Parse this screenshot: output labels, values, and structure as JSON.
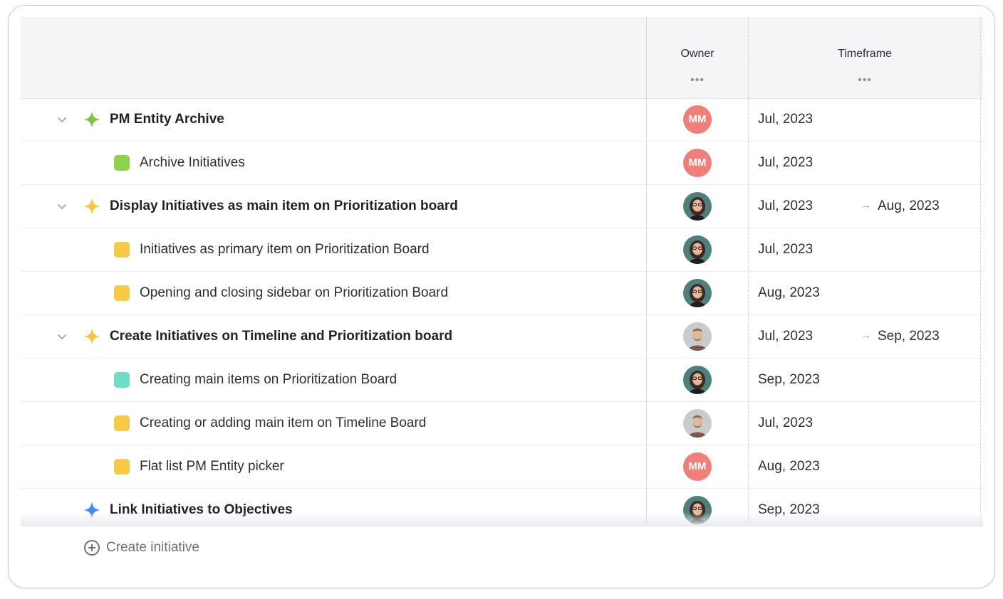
{
  "columns": {
    "owner": "Owner",
    "timeframe": "Timeframe",
    "more": "•••"
  },
  "rows": [
    {
      "title": "PM Entity Archive",
      "level": "parent",
      "icon": "star-icon",
      "color": "#7cc243",
      "owner": "MM",
      "owner_type": "initials",
      "start": "Jul, 2023",
      "end": ""
    },
    {
      "title": "Archive Initiatives",
      "level": "child",
      "icon": "square-icon",
      "color": "#8fd14f",
      "owner": "MM",
      "owner_type": "initials",
      "start": "Jul, 2023",
      "end": ""
    },
    {
      "title": "Display Initiatives as main item on Prioritization board",
      "level": "parent",
      "icon": "star-icon",
      "color": "#f7c544",
      "owner": "",
      "owner_type": "woman",
      "start": "Jul, 2023",
      "end": "Aug, 2023"
    },
    {
      "title": "Initiatives as primary item on Prioritization Board",
      "level": "child",
      "icon": "square-icon",
      "color": "#f7c948",
      "owner": "",
      "owner_type": "woman",
      "start": "Jul, 2023",
      "end": ""
    },
    {
      "title": "Opening and closing sidebar on Prioritization Board",
      "level": "child",
      "icon": "square-icon",
      "color": "#f7c948",
      "owner": "",
      "owner_type": "woman",
      "start": "Aug, 2023",
      "end": ""
    },
    {
      "title": "Create Initiatives on Timeline and Prioritization board",
      "level": "parent",
      "icon": "star-icon",
      "color": "#f7c544",
      "owner": "",
      "owner_type": "man",
      "start": "Jul, 2023",
      "end": "Sep, 2023"
    },
    {
      "title": "Creating main items on Prioritization Board",
      "level": "child",
      "icon": "square-icon",
      "color": "#6ddcc8",
      "owner": "",
      "owner_type": "woman",
      "start": "Sep, 2023",
      "end": ""
    },
    {
      "title": "Creating or adding main item on Timeline Board",
      "level": "child",
      "icon": "square-icon",
      "color": "#f7c948",
      "owner": "",
      "owner_type": "man",
      "start": "Jul, 2023",
      "end": ""
    },
    {
      "title": "Flat list PM Entity picker",
      "level": "child",
      "icon": "square-icon",
      "color": "#f7c948",
      "owner": "MM",
      "owner_type": "initials",
      "start": "Aug, 2023",
      "end": ""
    },
    {
      "title": "Link Initiatives to Objectives",
      "level": "parent_no_toggle",
      "icon": "star-icon",
      "color": "#3d8ef5",
      "owner": "",
      "owner_type": "woman",
      "start": "Sep, 2023",
      "end": ""
    }
  ],
  "arrow": "→",
  "footer": {
    "create_label": "Create initiative",
    "icon": "plus-circle-icon"
  }
}
